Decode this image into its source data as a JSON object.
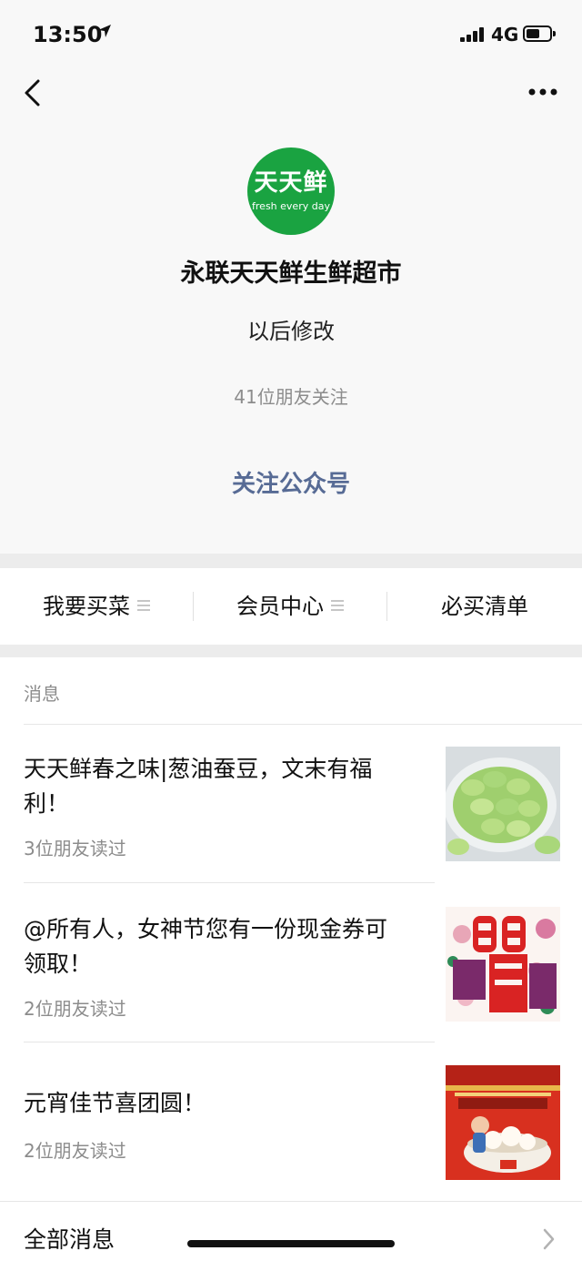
{
  "status_bar": {
    "time": "13:50",
    "network": "4G"
  },
  "account": {
    "logo_text": "天天鲜",
    "logo_tagline": "fresh every day",
    "name": "永联天天鲜生鲜超市",
    "description": "以后修改",
    "followers": "41位朋友关注",
    "follow_button": "关注公众号"
  },
  "menu": [
    {
      "label": "我要买菜"
    },
    {
      "label": "会员中心"
    },
    {
      "label": "必买清单"
    }
  ],
  "messages": {
    "section_title": "消息",
    "articles": [
      {
        "title": "天天鲜春之味|葱油蚕豆，文末有福利！",
        "meta": "3位朋友读过"
      },
      {
        "title": "@所有人，女神节您有一份现金券可领取！",
        "meta": "2位朋友读过"
      },
      {
        "title": "元宵佳节喜团圆！",
        "meta": "2位朋友读过"
      }
    ],
    "all_messages": "全部消息"
  },
  "colors": {
    "accent": "#576b95",
    "logo_green": "#1aa341"
  }
}
